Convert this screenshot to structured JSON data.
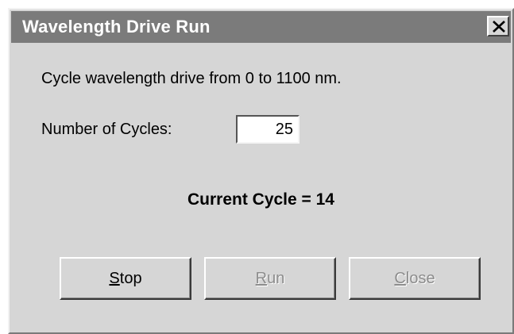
{
  "window": {
    "title": "Wavelength Drive Run",
    "close_icon": "close-x-icon"
  },
  "body": {
    "description": "Cycle wavelength drive from 0 to 1100 nm.",
    "cycles_label": "Number of Cycles:",
    "cycles_value": "25",
    "current_cycle": "Current Cycle = 14"
  },
  "buttons": {
    "stop": {
      "mnemonic": "S",
      "rest": "top",
      "enabled": true
    },
    "run": {
      "mnemonic": "R",
      "rest": "un",
      "enabled": false
    },
    "close": {
      "mnemonic": "C",
      "rest": "lose",
      "enabled": false
    }
  },
  "colors": {
    "titlebar": "#7b7b7b",
    "dialog_face": "#d6d6d6",
    "disabled_text": "#8c8c8c"
  }
}
